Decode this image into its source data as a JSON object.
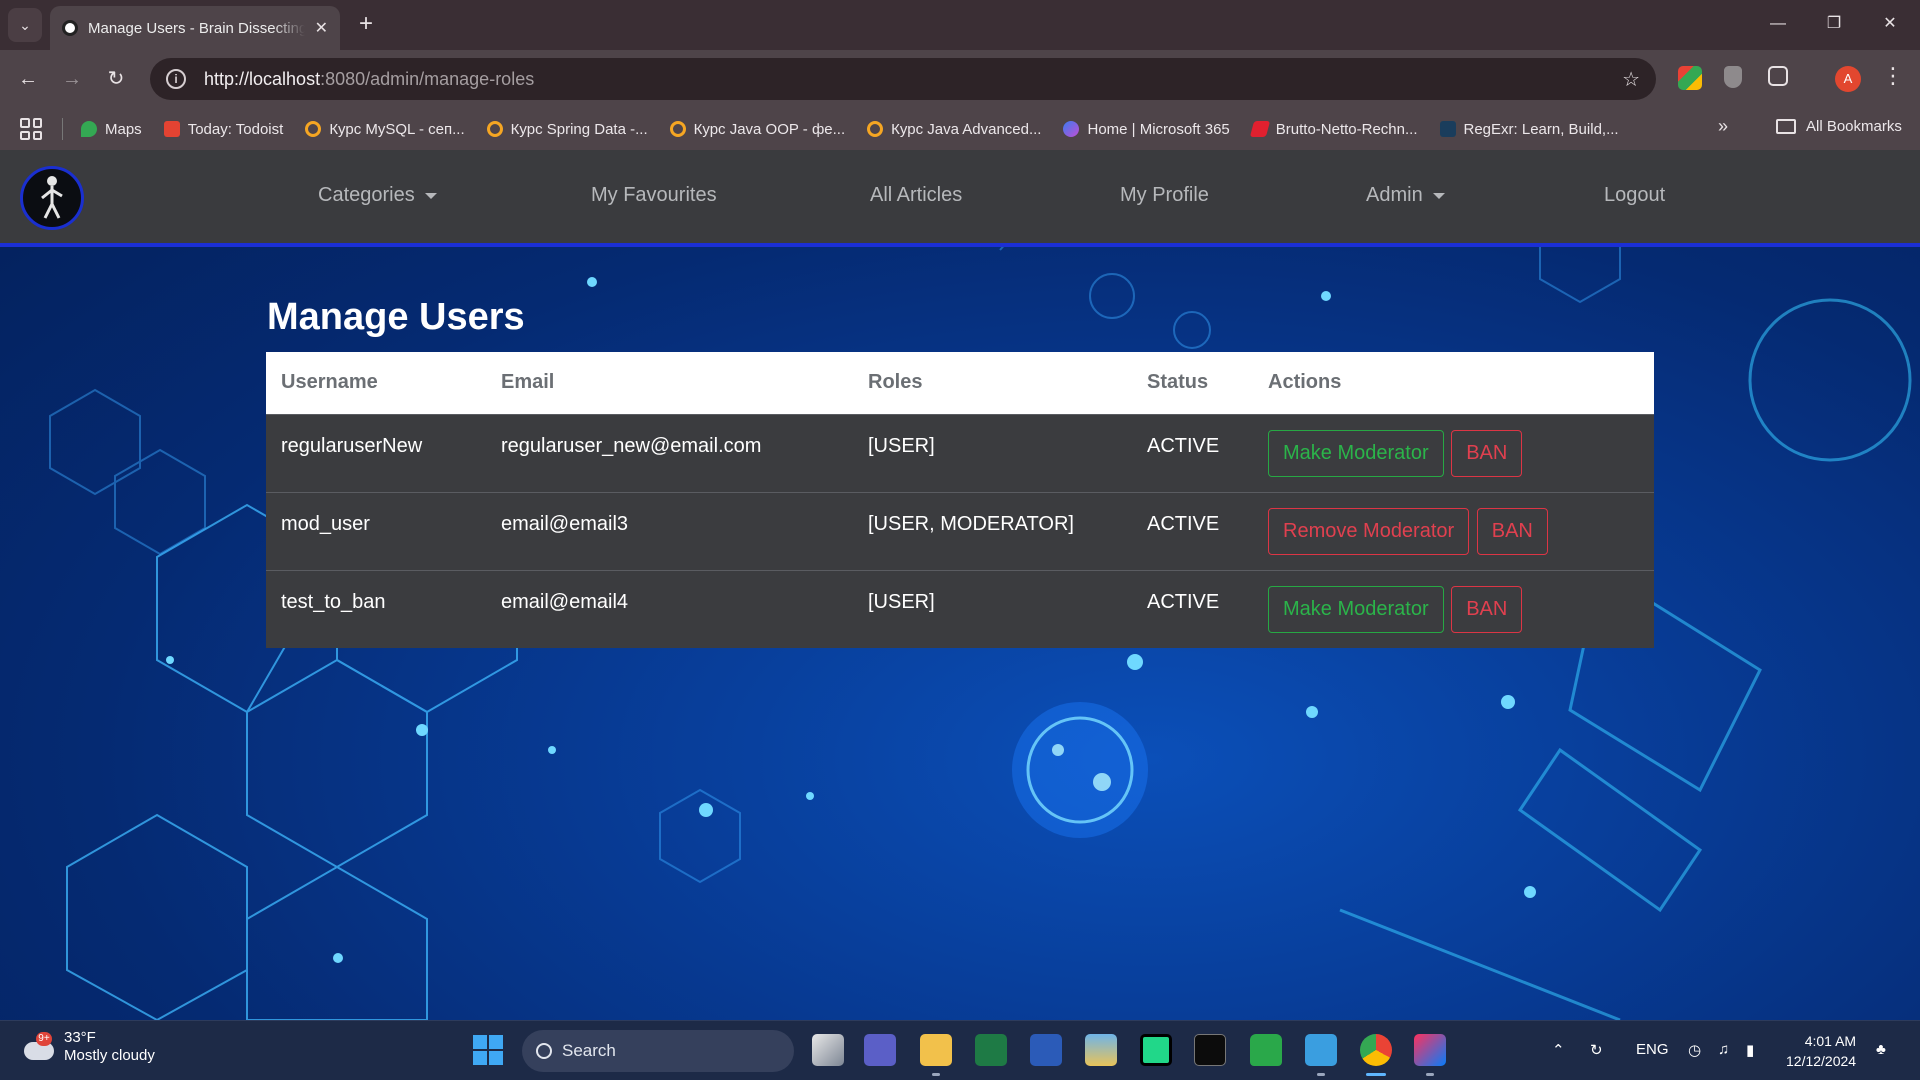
{
  "browser": {
    "tab_title": "Manage Users - Brain Dissecting",
    "new_tab": "+",
    "url_host": "http://localhost",
    "url_rest": ":8080/admin/manage-roles",
    "avatar_letter": "A",
    "bookmarks": [
      {
        "label": "Maps",
        "color": "#34a853"
      },
      {
        "label": "Today: Todoist",
        "color": "#e44332"
      },
      {
        "label": "Курс MySQL - сеп...",
        "color": "#f5a623"
      },
      {
        "label": "Курс Spring Data -...",
        "color": "#f5a623"
      },
      {
        "label": "Курс Java OOP - фе...",
        "color": "#f5a623"
      },
      {
        "label": "Курс Java Advanced...",
        "color": "#f5a623"
      },
      {
        "label": "Home | Microsoft 365",
        "color": "#7b5cf0"
      },
      {
        "label": "Brutto-Netto-Rechn...",
        "color": "#e0202f"
      },
      {
        "label": "RegExr: Learn, Build,...",
        "color": "#1a3d5c"
      }
    ],
    "bookmarks_more": "»",
    "all_bookmarks": "All Bookmarks"
  },
  "navbar": {
    "categories": "Categories",
    "favourites": "My Favourites",
    "articles": "All Articles",
    "profile": "My Profile",
    "admin": "Admin",
    "logout": "Logout"
  },
  "page": {
    "title": "Manage Users",
    "columns": [
      "Username",
      "Email",
      "Roles",
      "Status",
      "Actions"
    ],
    "users": [
      {
        "username": "regularuserNew",
        "email": "regularuser_new@email.com",
        "roles": "[USER]",
        "status": "ACTIVE",
        "action1": "Make Moderator",
        "action2": "BAN"
      },
      {
        "username": "mod_user",
        "email": "email@email3",
        "roles": "[USER, MODERATOR]",
        "status": "ACTIVE",
        "action1": "Remove Moderator",
        "action2": "BAN"
      },
      {
        "username": "test_to_ban",
        "email": "email@email4",
        "roles": "[USER]",
        "status": "ACTIVE",
        "action1": "Make Moderator",
        "action2": "BAN"
      }
    ]
  },
  "taskbar": {
    "weather_badge": "9+",
    "temperature": "33°F",
    "condition": "Mostly cloudy",
    "search_label": "Search",
    "language": "ENG",
    "time": "4:01 AM",
    "date": "12/12/2024"
  },
  "colors": {
    "nav_accent": "#1b2fd6",
    "status_active": "#2bb44a",
    "btn_green": "#27a844",
    "btn_red": "#dc3545"
  }
}
